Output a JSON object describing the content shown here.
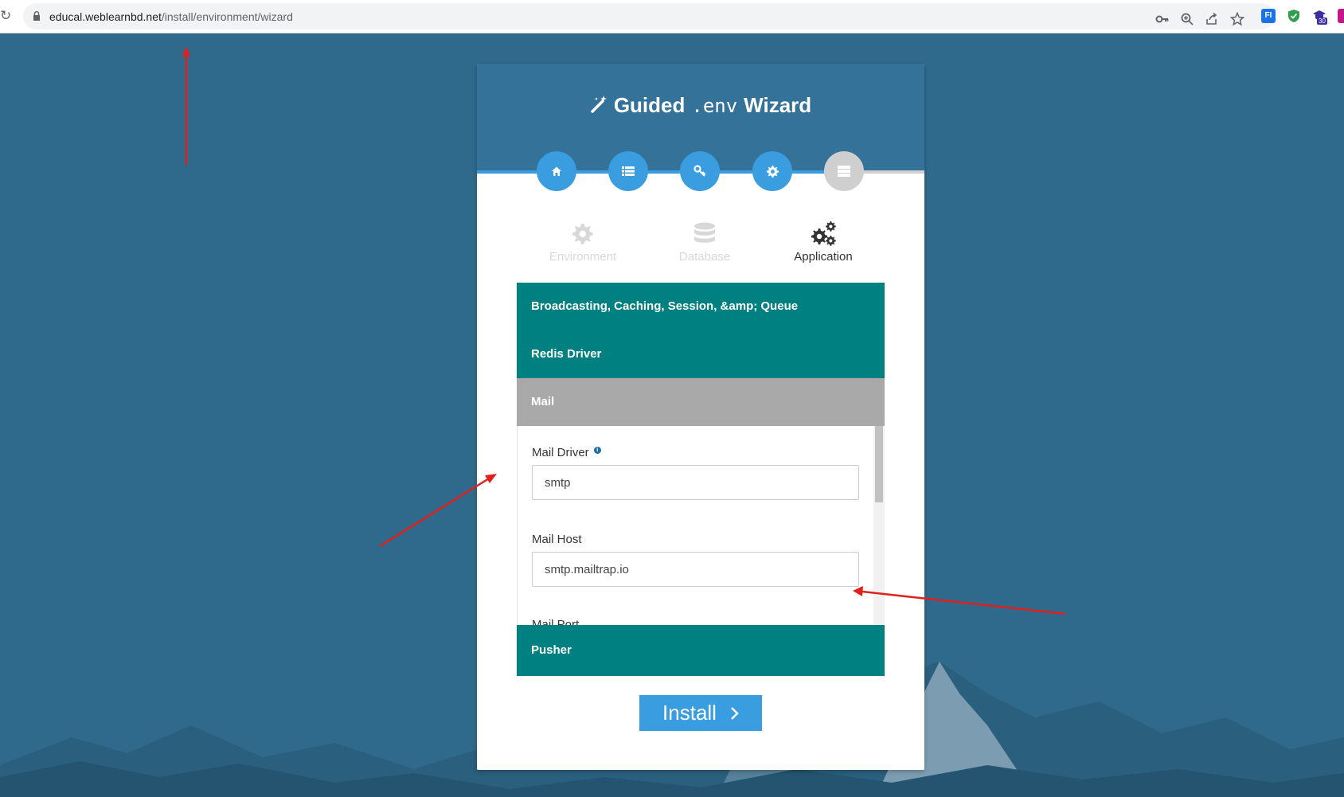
{
  "browser": {
    "url_host": "educal.weblearnbd.net",
    "url_path": "/install/environment/wizard",
    "extension_badge": "30",
    "ext_label": "FI"
  },
  "wizard": {
    "title_left": "Guided",
    "title_mono": ".env",
    "title_right": "Wizard",
    "steps": [
      {
        "icon": "home-icon",
        "state": "complete"
      },
      {
        "icon": "list-icon",
        "state": "complete"
      },
      {
        "icon": "key-icon",
        "state": "complete"
      },
      {
        "icon": "gear-icon",
        "state": "complete"
      },
      {
        "icon": "server-icon",
        "state": "pending"
      }
    ],
    "tabs": [
      {
        "label": "Environment",
        "icon": "gear-icon",
        "active": false
      },
      {
        "label": "Database",
        "icon": "database-icon",
        "active": false
      },
      {
        "label": "Application",
        "icon": "gears-icon",
        "active": true
      }
    ],
    "sections": {
      "broadcasting": "Broadcasting, Caching, Session, &amp; Queue",
      "redis": "Redis Driver",
      "mail": "Mail",
      "pusher": "Pusher"
    },
    "mail_fields": {
      "driver_label": "Mail Driver",
      "driver_value": "smtp",
      "host_label": "Mail Host",
      "host_value": "smtp.mailtrap.io",
      "port_label": "Mail Port"
    },
    "install_label": "Install"
  },
  "colors": {
    "background": "#2f6a8d",
    "header": "#34729a",
    "accent": "#3a9de0",
    "teal": "#008080",
    "grey": "#a9a9a9",
    "annotation_arrow": "#e0201c"
  }
}
